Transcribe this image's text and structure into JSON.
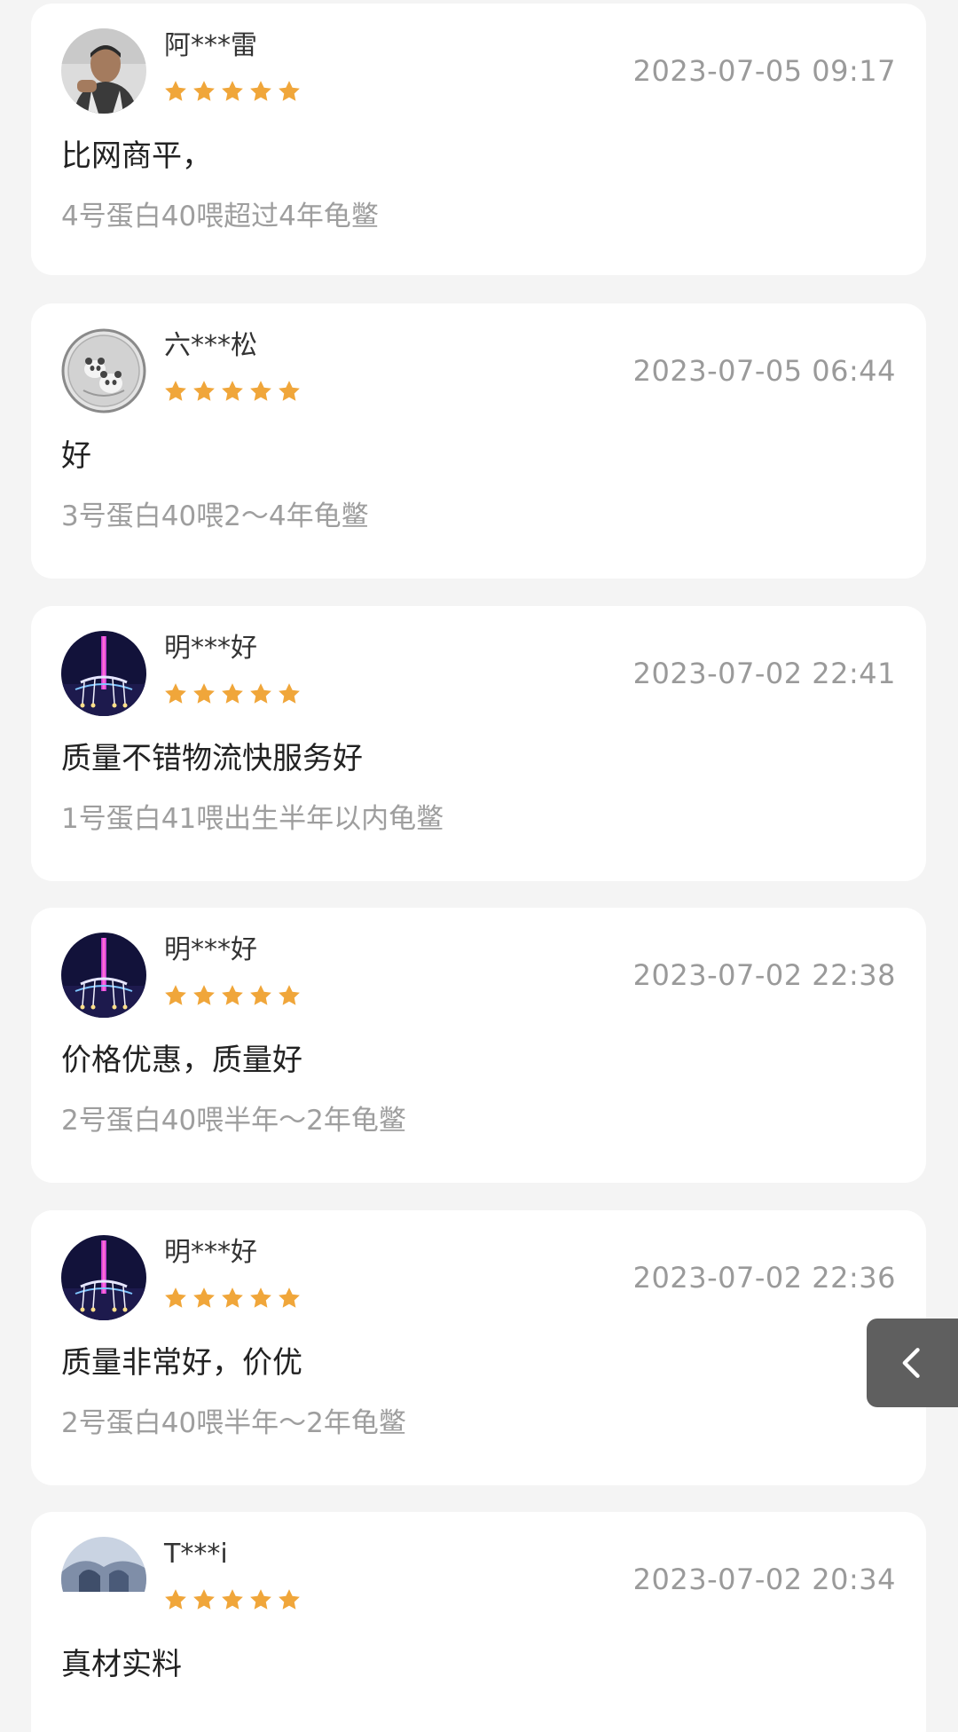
{
  "colors": {
    "page_background": "#f4f4f4",
    "card_background": "#ffffff",
    "star": "#f0a63a",
    "date_text": "#9a9a9a",
    "spec_text": "#9e9e9e",
    "back_button": "#5f5f5f"
  },
  "icons": {
    "star": "star-icon",
    "back": "chevron-left-icon"
  },
  "reviews": [
    {
      "username": "阿***雷",
      "rating": 5,
      "date": "2023-07-05 09:17",
      "comment": "比网商平，",
      "spec": "4号蛋白40喂超过4年龟鳖",
      "avatar": "person-photo"
    },
    {
      "username": "六***松",
      "rating": 5,
      "date": "2023-07-05 06:44",
      "comment": "好",
      "spec": "3号蛋白40喂2～4年龟鳖",
      "avatar": "panda-coin"
    },
    {
      "username": "明***好",
      "rating": 5,
      "date": "2023-07-02 22:41",
      "comment": "质量不错物流快服务好",
      "spec": "1号蛋白41喂出生半年以内龟鳖",
      "avatar": "night-tower"
    },
    {
      "username": "明***好",
      "rating": 5,
      "date": "2023-07-02 22:38",
      "comment": "价格优惠，质量好",
      "spec": "2号蛋白40喂半年～2年龟鳖",
      "avatar": "night-tower"
    },
    {
      "username": "明***好",
      "rating": 5,
      "date": "2023-07-02 22:36",
      "comment": "质量非常好，价优",
      "spec": "2号蛋白40喂半年～2年龟鳖",
      "avatar": "night-tower"
    },
    {
      "username": "T***i",
      "rating": 5,
      "date": "2023-07-02 20:34",
      "comment": "真材实料",
      "spec": "",
      "avatar": "landscape-photo"
    }
  ]
}
